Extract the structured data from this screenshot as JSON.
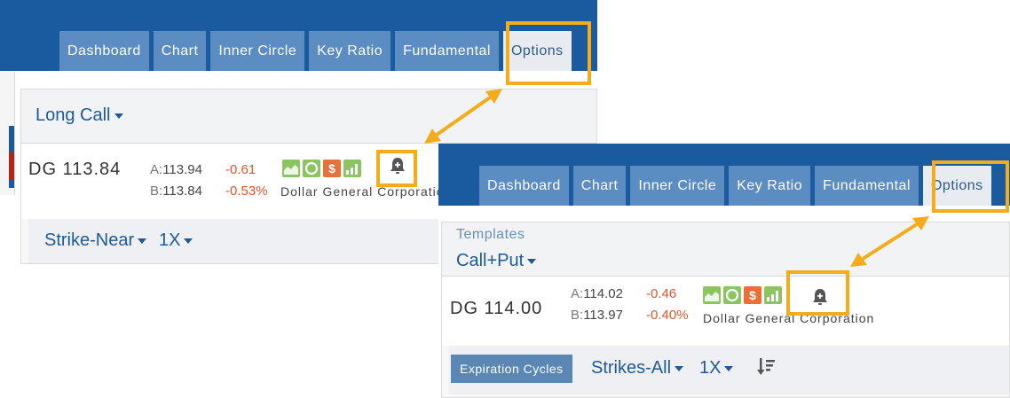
{
  "tabs": [
    "Dashboard",
    "Chart",
    "Inner Circle",
    "Key Ratio",
    "Fundamental",
    "Options"
  ],
  "active_tab": "Options",
  "panel_a": {
    "template": "Long Call",
    "symbol": "DG 113.84",
    "ask_label": "A:",
    "ask": "113.94",
    "bid_label": "B:",
    "bid": "113.84",
    "change": "-0.61",
    "change_pct": "-0.53%",
    "company": "Dollar General Corporation",
    "strike_control": "Strike-Near",
    "multiplier": "1X"
  },
  "panel_b": {
    "templates_label": "Templates",
    "template": "Call+Put",
    "symbol": "DG 114.00",
    "ask_label": "A:",
    "ask": "114.02",
    "bid_label": "B:",
    "bid": "113.97",
    "change": "-0.46",
    "change_pct": "-0.40%",
    "company": "Dollar General Corporation",
    "expiration_button": "Expiration Cycles",
    "strike_control": "Strikes-All",
    "multiplier": "1X"
  },
  "icons": {
    "quick_icons": [
      "trend-chart-icon",
      "circle-icon",
      "dollar-icon",
      "bar-signal-icon"
    ],
    "alert": "bell-plus-icon",
    "sort": "sort-descending-icon"
  },
  "colors": {
    "topbar": "#1a5a9e",
    "tab": "#5b8cc2",
    "active_tab": "#e8ebef",
    "highlight": "#f4ac1c",
    "negative": "#e0572d",
    "icon_green": "#8cc461",
    "icon_orange": "#e8703a"
  }
}
